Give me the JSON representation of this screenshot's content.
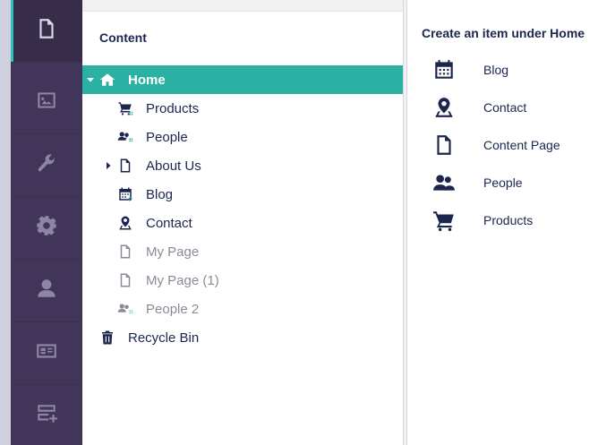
{
  "tree": {
    "title": "Content",
    "nodes": [
      {
        "label": "Home",
        "icon": "home-icon",
        "selected": true,
        "expanded": true
      },
      {
        "label": "Products",
        "icon": "cart-icon"
      },
      {
        "label": "People",
        "icon": "people-icon"
      },
      {
        "label": "About Us",
        "icon": "document-icon",
        "collapsed": true
      },
      {
        "label": "Blog",
        "icon": "calendar-icon"
      },
      {
        "label": "Contact",
        "icon": "map-pin-icon"
      },
      {
        "label": "My Page",
        "icon": "document-icon",
        "muted": true
      },
      {
        "label": "My Page (1)",
        "icon": "document-icon",
        "muted": true
      },
      {
        "label": "People 2",
        "icon": "people-icon",
        "muted": true
      },
      {
        "label": "Recycle Bin",
        "icon": "trash-icon"
      }
    ]
  },
  "create_dialog": {
    "title": "Create an item under Home",
    "items": [
      {
        "label": "Blog",
        "icon": "calendar-icon"
      },
      {
        "label": "Contact",
        "icon": "map-pin-icon"
      },
      {
        "label": "Content Page",
        "icon": "document-icon"
      },
      {
        "label": "People",
        "icon": "people-icon"
      },
      {
        "label": "Products",
        "icon": "cart-icon"
      }
    ]
  },
  "sections": [
    {
      "name": "content",
      "icon": "document-icon",
      "active": true
    },
    {
      "name": "media",
      "icon": "image-icon"
    },
    {
      "name": "settings",
      "icon": "wrench-icon"
    },
    {
      "name": "packages",
      "icon": "gear-icon"
    },
    {
      "name": "users",
      "icon": "user-icon"
    },
    {
      "name": "members",
      "icon": "id-card-icon"
    },
    {
      "name": "forms",
      "icon": "form-icon"
    }
  ],
  "colors": {
    "rail": "#413659",
    "accent": "#2bb0a4",
    "text": "#1b264f",
    "muted_text": "#8a8b96"
  }
}
